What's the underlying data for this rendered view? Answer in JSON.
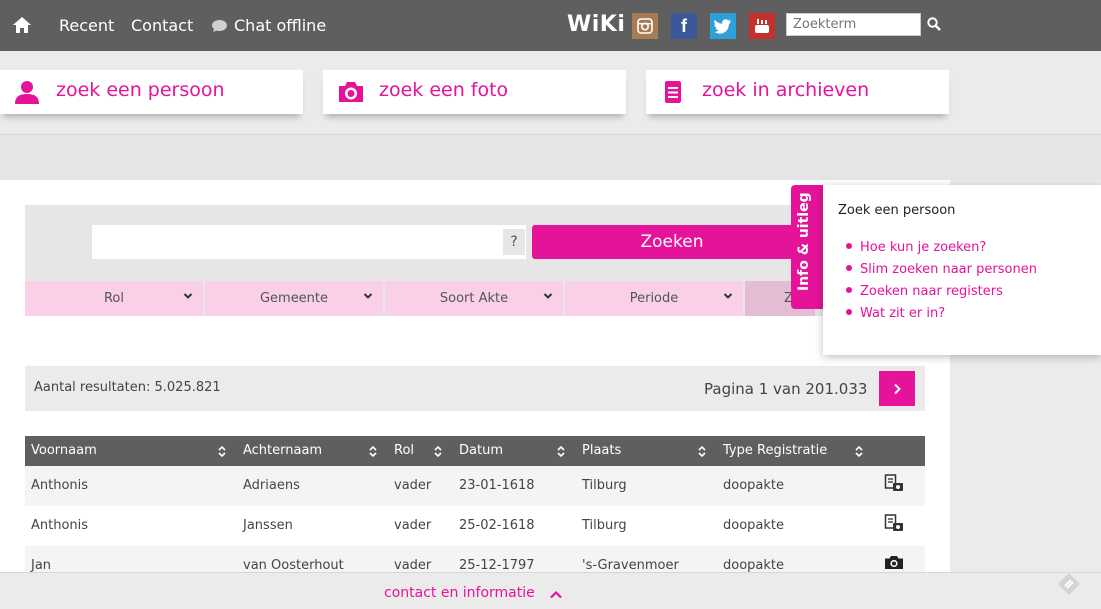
{
  "topbar": {
    "nav": [
      "Recent",
      "Contact"
    ],
    "chat": "Chat offline",
    "wiki": "WiKi",
    "search_placeholder": "Zoekterm",
    "social": [
      {
        "name": "instagram-icon",
        "color": "#a67c52"
      },
      {
        "name": "facebook-icon",
        "color": "#3b5998",
        "glyph": "f"
      },
      {
        "name": "twitter-icon",
        "color": "#2d9fd9"
      },
      {
        "name": "youtube-icon",
        "color": "#c4302b"
      }
    ]
  },
  "tabs": [
    {
      "label": "zoek een persoon",
      "icon": "person-icon"
    },
    {
      "label": "zoek een foto",
      "icon": "camera-icon"
    },
    {
      "label": "zoek in archieven",
      "icon": "document-icon"
    }
  ],
  "search": {
    "help": "?",
    "button": "Zoeken",
    "filters": [
      "Rol",
      "Gemeente",
      "Soort Akte",
      "Periode"
    ],
    "filter_partial": "Z"
  },
  "results": {
    "count_label": "Aantal resultaten: 5.025.821",
    "page_label": "Pagina 1 van 201.033"
  },
  "table": {
    "columns": [
      "Voornaam",
      "Achternaam",
      "Rol",
      "Datum",
      "Plaats",
      "Type Registratie"
    ],
    "rows": [
      {
        "voornaam": "Anthonis",
        "achternaam": "Adriaens",
        "rol": "vader",
        "datum": "23-01-1618",
        "plaats": "Tilburg",
        "type": "doopakte",
        "icon": "scan-document-icon"
      },
      {
        "voornaam": "Anthonis",
        "achternaam": "Janssen",
        "rol": "vader",
        "datum": "25-02-1618",
        "plaats": "Tilburg",
        "type": "doopakte",
        "icon": "scan-document-icon"
      },
      {
        "voornaam": "Jan",
        "achternaam": "van Oosterhout",
        "rol": "vader",
        "datum": "25-12-1797",
        "plaats": "'s-Gravenmoer",
        "type": "doopakte",
        "icon": "camera-icon"
      }
    ]
  },
  "info": {
    "tab_label": "Info & uitleg",
    "title": "Zoek een persoon",
    "links": [
      "Hoe kun je zoeken?",
      "Slim zoeken naar personen",
      "Zoeken naar registers",
      "Wat zit er in?"
    ]
  },
  "footer": {
    "link": "contact en informatie"
  },
  "colors": {
    "accent": "#e5139a",
    "topbar": "#5f5f5f",
    "filter_bg": "#f9d0e8"
  }
}
